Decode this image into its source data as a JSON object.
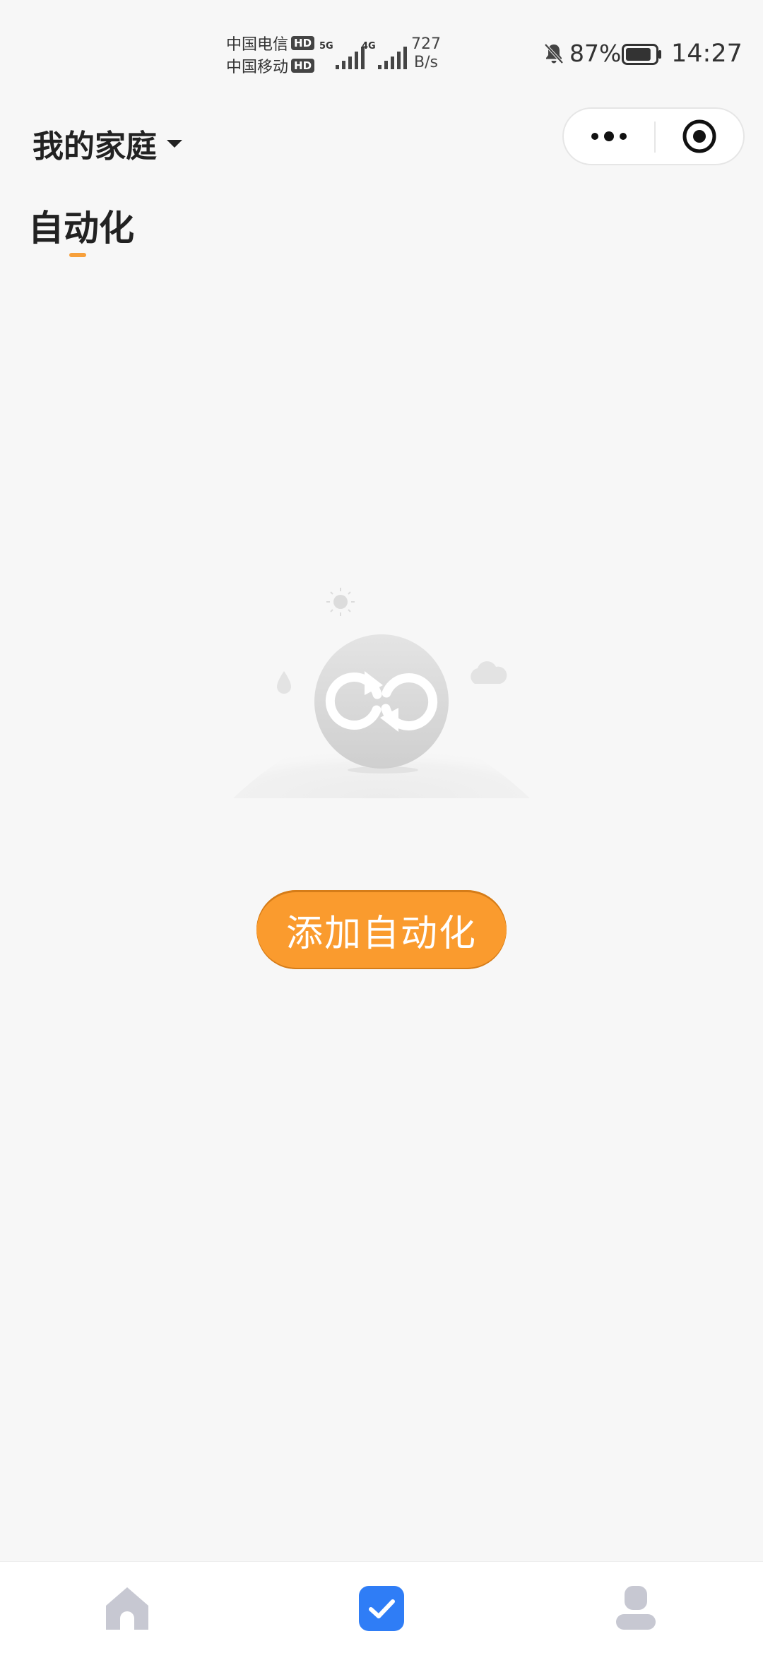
{
  "status_bar": {
    "carrier_1": "中国电信",
    "carrier_2": "中国移动",
    "hd_badge": "HD",
    "network_1": "5G",
    "network_2": "4G",
    "speed_value": "727",
    "speed_unit": "B/s",
    "battery_percent": "87%",
    "battery_level": 0.87,
    "time": "14:27",
    "icons": [
      "bell-muted-icon",
      "battery-icon"
    ]
  },
  "header": {
    "home_name": "我的家庭",
    "home_dropdown_icon": "caret-down-icon",
    "capsule_icons": [
      "more-icon",
      "close-miniprogram-icon"
    ]
  },
  "tabs": [
    {
      "label": "自动化",
      "active": true
    }
  ],
  "empty_state": {
    "illustration_icon": "automation-loop-icon",
    "button_label": "添加自动化"
  },
  "bottom_nav": {
    "items": [
      {
        "name": "home",
        "icon": "home-icon",
        "active": false
      },
      {
        "name": "automation",
        "icon": "check-square-icon",
        "active": true
      },
      {
        "name": "profile",
        "icon": "user-icon",
        "active": false
      }
    ]
  },
  "colors": {
    "accent": "#fa9b2e",
    "tab_indicator": "#f7a03b",
    "nav_active": "#2f7df6",
    "nav_inactive": "#c7c8d2",
    "background": "#f7f7f7"
  }
}
